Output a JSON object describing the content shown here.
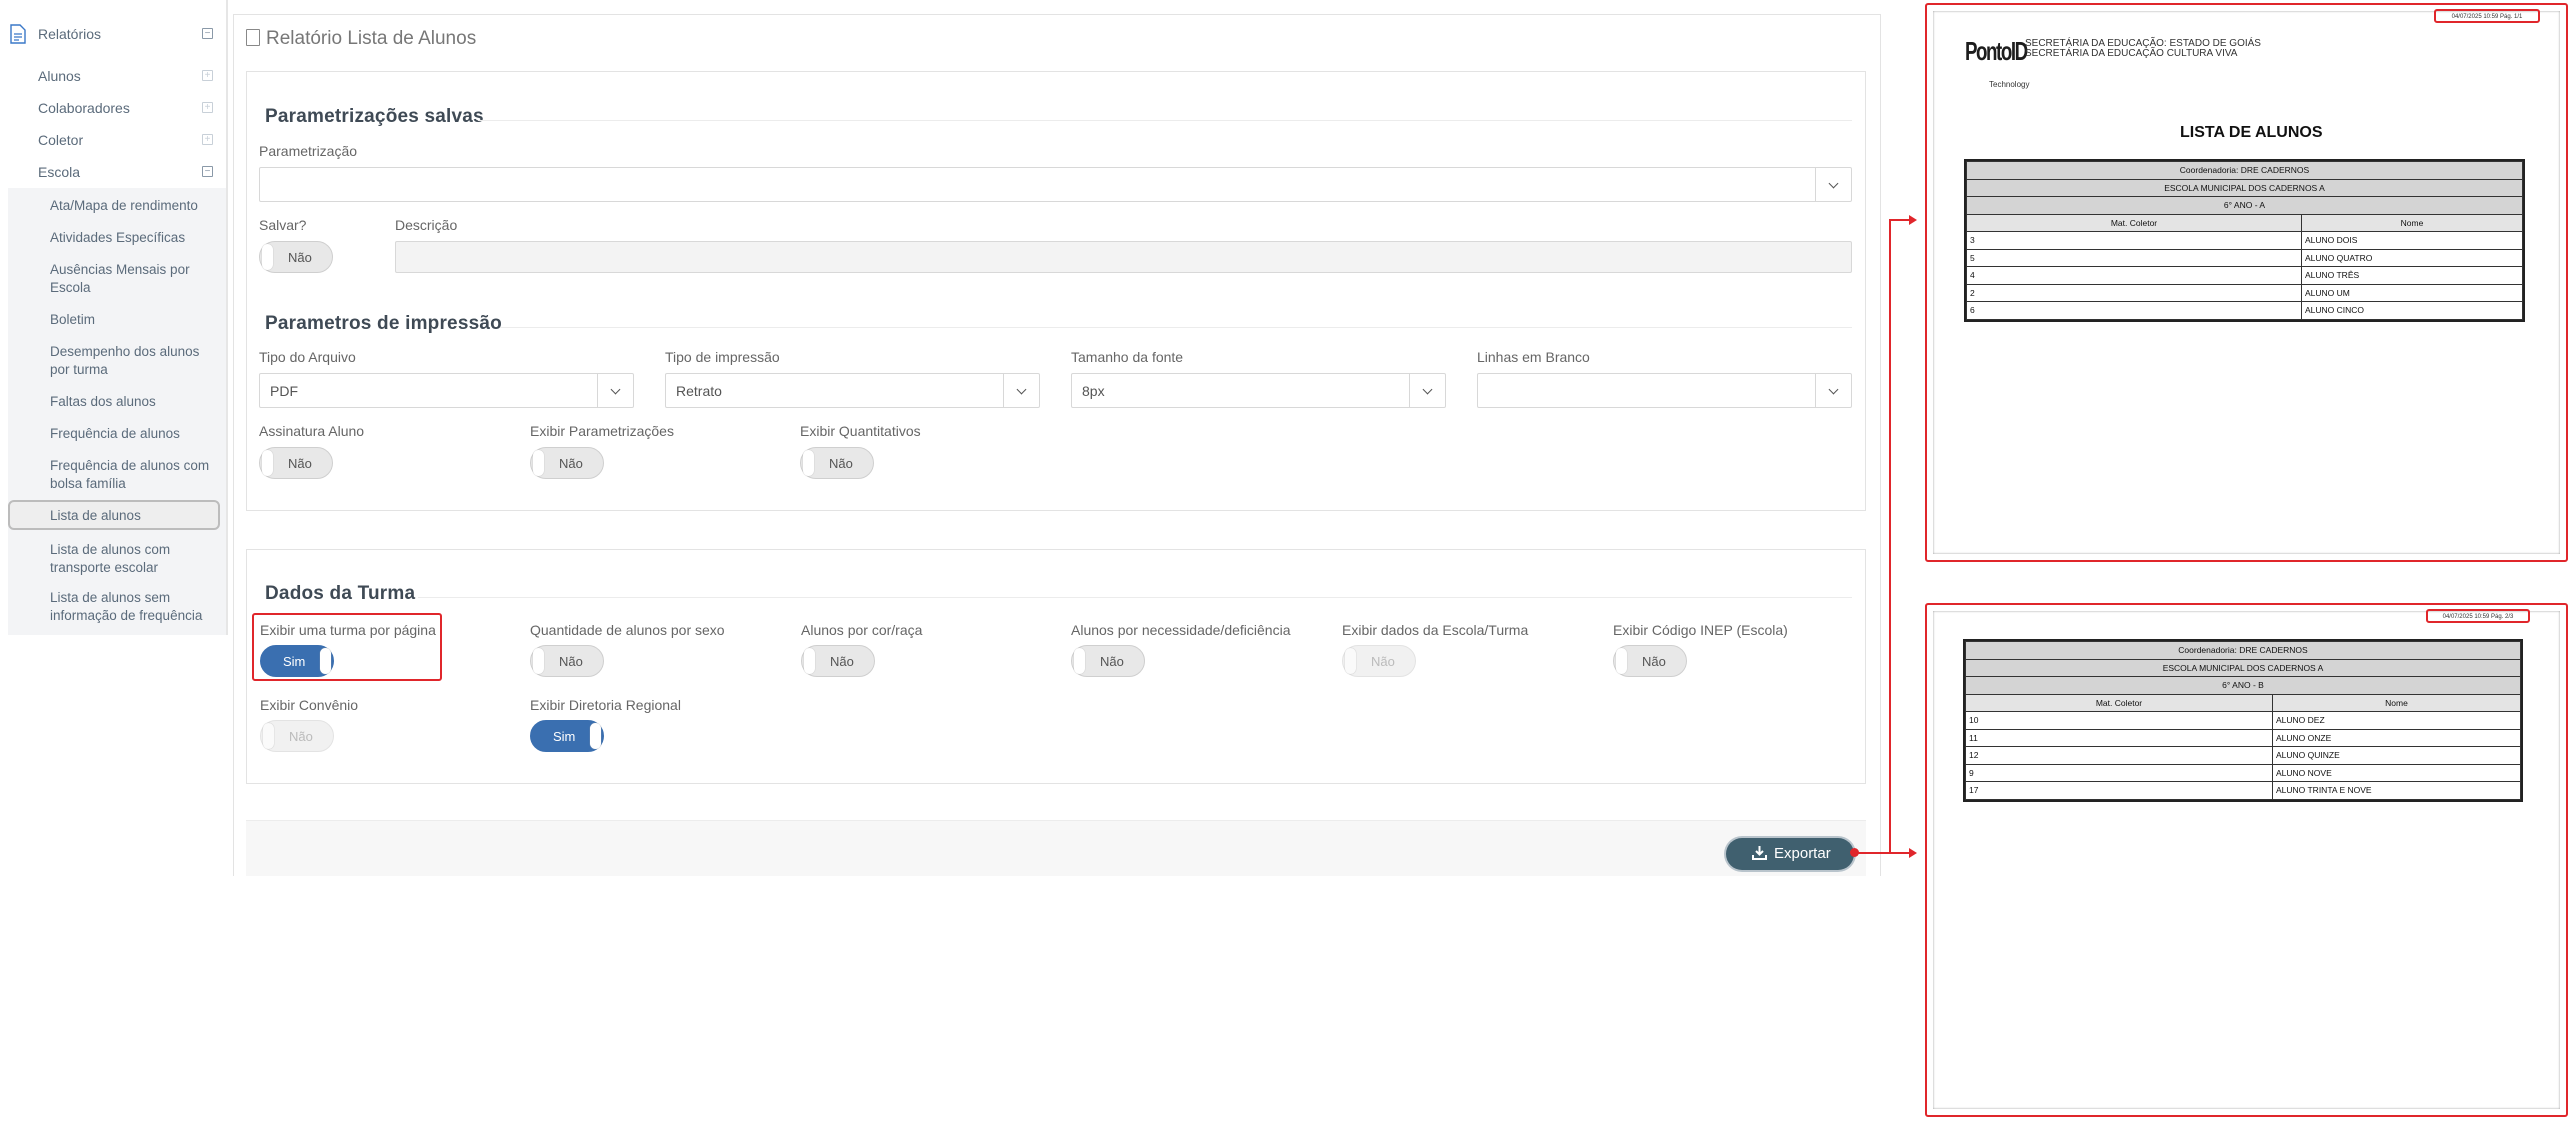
{
  "sidebar": {
    "top_label": "Relatórios",
    "items": [
      {
        "label": "Alunos",
        "toggle": "+"
      },
      {
        "label": "Colaboradores",
        "toggle": "+"
      },
      {
        "label": "Coletor",
        "toggle": "+"
      },
      {
        "label": "Escola",
        "toggle": "−"
      }
    ],
    "top_toggle": "−",
    "sub_items": [
      {
        "label": "Ata/Mapa de rendimento"
      },
      {
        "label": "Atividades Específicas"
      },
      {
        "label": "Ausências Mensais por Escola"
      },
      {
        "label": "Boletim"
      },
      {
        "label": "Desempenho dos alunos por turma"
      },
      {
        "label": "Faltas dos alunos"
      },
      {
        "label": "Frequência de alunos"
      },
      {
        "label": "Frequência de alunos com bolsa família"
      },
      {
        "label": "Lista de alunos",
        "active": true
      },
      {
        "label": "Lista de alunos com transporte escolar"
      },
      {
        "label": "Lista de alunos sem informação de frequência"
      }
    ]
  },
  "page": {
    "title": "Relatório Lista de Alunos"
  },
  "saved": {
    "legend": "Parametrizações salvas",
    "param_label": "Parametrização",
    "param_value": "",
    "save_label": "Salvar?",
    "save_value": "Não",
    "desc_label": "Descrição",
    "desc_value": ""
  },
  "print": {
    "legend": "Parametros de impressão",
    "file_type_label": "Tipo do Arquivo",
    "file_type_value": "PDF",
    "print_type_label": "Tipo de impressão",
    "print_type_value": "Retrato",
    "font_size_label": "Tamanho da fonte",
    "font_size_value": "8px",
    "blank_lines_label": "Linhas em Branco",
    "blank_lines_value": "",
    "signature_label": "Assinatura Aluno",
    "signature_value": "Não",
    "show_params_label": "Exibir Parametrizações",
    "show_params_value": "Não",
    "show_quant_label": "Exibir Quantitativos",
    "show_quant_value": "Não"
  },
  "class_data": {
    "legend": "Dados da Turma",
    "one_per_page_label": "Exibir uma turma por página",
    "one_per_page_value": "Sim",
    "by_sex_label": "Quantidade de alunos por sexo",
    "by_sex_value": "Não",
    "by_race_label": "Alunos por cor/raça",
    "by_race_value": "Não",
    "by_need_label": "Alunos por necessidade/deficiência",
    "by_need_value": "Não",
    "school_data_label": "Exibir dados da Escola/Turma",
    "school_data_value": "Não",
    "inep_label": "Exibir Código INEP (Escola)",
    "inep_value": "Não",
    "covenant_label": "Exibir Convênio",
    "covenant_value": "Não",
    "regional_label": "Exibir Diretoria Regional",
    "regional_value": "Sim"
  },
  "export": {
    "label": "Exportar"
  },
  "preview": {
    "page1": {
      "stamp": "04/07/2025 10:59   Pág. 1/1",
      "org_line1": "SECRETÁRIA DA EDUCAÇÃO: ESTADO DE GOIÁS",
      "org_line2": "SECRETÁRIA DA EDUCAÇÃO CULTURA VIVA",
      "logo_text": "PontoID",
      "logo_sub": "Technology",
      "title": "LISTA DE ALUNOS",
      "coord": "Coordenadoria: DRE CADERNOS",
      "school": "ESCOLA MUNICIPAL DOS CADERNOS A",
      "grade": "6° ANO - A",
      "col1": "Mat. Coletor",
      "col2": "Nome",
      "rows": [
        {
          "mat": "3",
          "name": "ALUNO DOIS"
        },
        {
          "mat": "5",
          "name": "ALUNO QUATRO"
        },
        {
          "mat": "4",
          "name": "ALUNO TRÊS"
        },
        {
          "mat": "2",
          "name": "ALUNO UM"
        },
        {
          "mat": "6",
          "name": "ALUNO CINCO"
        }
      ]
    },
    "page2": {
      "stamp": "04/07/2025 10:59   Pág. 2/3",
      "coord": "Coordenadoria: DRE CADERNOS",
      "school": "ESCOLA MUNICIPAL DOS CADERNOS A",
      "grade": "6° ANO - B",
      "col1": "Mat. Coletor",
      "col2": "Nome",
      "rows": [
        {
          "mat": "10",
          "name": "ALUNO DEZ"
        },
        {
          "mat": "11",
          "name": "ALUNO ONZE"
        },
        {
          "mat": "12",
          "name": "ALUNO QUINZE"
        },
        {
          "mat": "9",
          "name": "ALUNO NOVE"
        },
        {
          "mat": "17",
          "name": "ALUNO TRINTA E NOVE"
        }
      ]
    }
  },
  "colors": {
    "highlight": "#e0262b",
    "switch_on": "#3a6fb0",
    "export_button": "#40606f"
  }
}
